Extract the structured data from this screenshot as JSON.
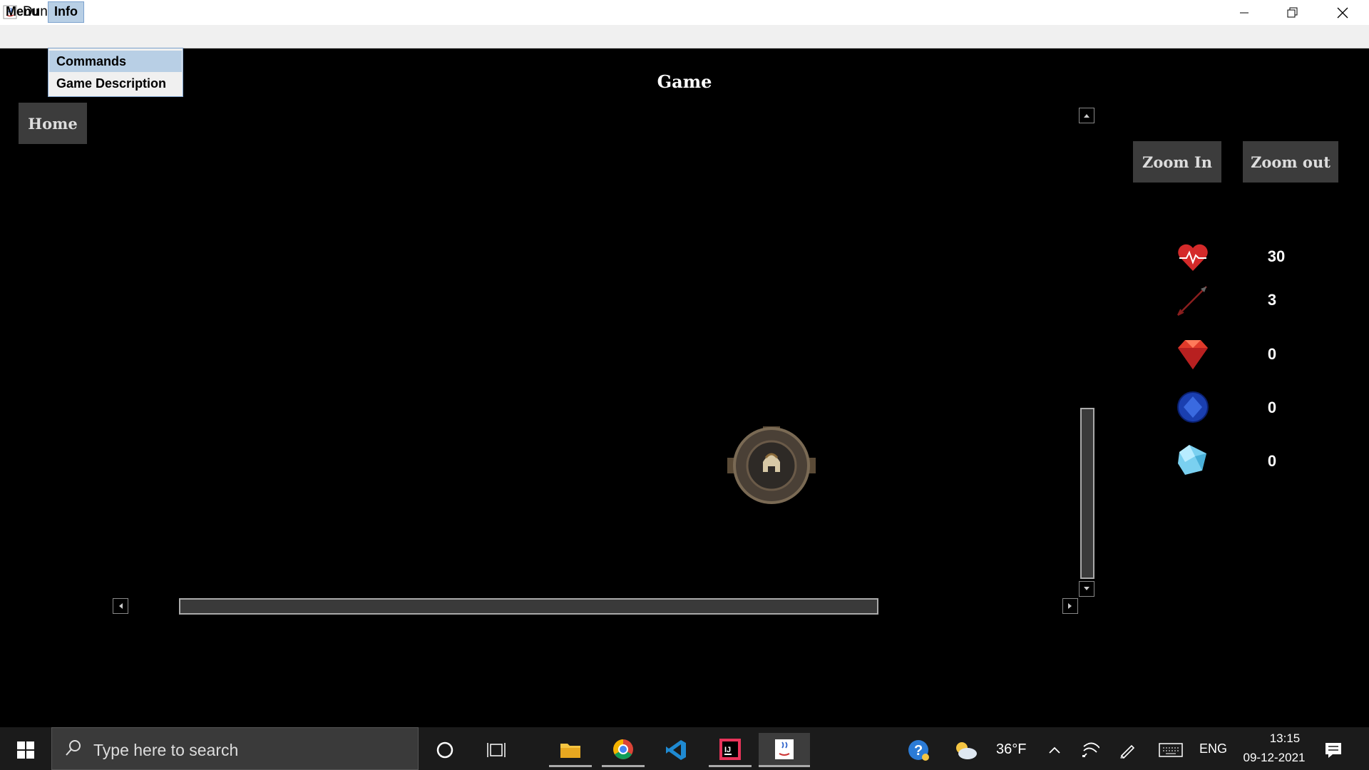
{
  "window": {
    "title": "Dungeon"
  },
  "menubar": {
    "menu": "Menu",
    "info": "Info"
  },
  "dropdown": {
    "items": [
      "Commands",
      "Game Description"
    ]
  },
  "game": {
    "title": "Game",
    "home_label": "Home",
    "zoom_in_label": "Zoom In",
    "zoom_out_label": "Zoom out",
    "stats": [
      {
        "icon": "heart-health-icon",
        "value": "30"
      },
      {
        "icon": "arrow-icon",
        "value": "3"
      },
      {
        "icon": "ruby-icon",
        "value": "0"
      },
      {
        "icon": "sapphire-icon",
        "value": "0"
      },
      {
        "icon": "diamond-icon",
        "value": "0"
      }
    ]
  },
  "taskbar": {
    "search_placeholder": "Type here to search",
    "weather": "36°F",
    "language": "ENG",
    "time": "13:15",
    "date": "09-12-2021"
  },
  "colors": {
    "background": "#000000",
    "button_bg": "#3c3c3c",
    "menu_highlight": "#b8cfe5"
  }
}
